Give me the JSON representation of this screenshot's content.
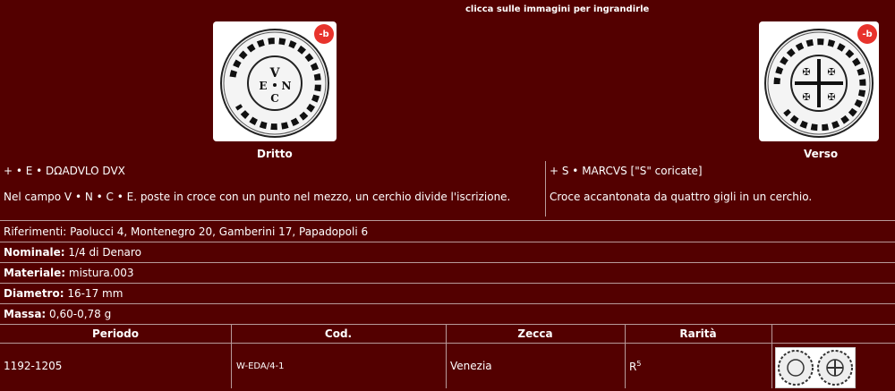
{
  "hint": "clicca sulle immagini per ingrandirle",
  "obverse": {
    "caption": "Dritto",
    "legend": "+ • E • DΩADVLO DVX",
    "field": "Nel campo V • N • C • E. poste in croce con un punto nel mezzo, un cerchio divide l'iscrizione.",
    "image_icon": "coin-obverse-image"
  },
  "reverse": {
    "caption": "Verso",
    "legend": "+ S • MARCVS [\"S\" coricate]",
    "field": "Croce accantonata da quattro gigli in un cerchio.",
    "image_icon": "coin-reverse-image"
  },
  "badge_text": "-b",
  "details": {
    "riferimenti": "Riferimenti: Paolucci 4, Montenegro 20, Gamberini 17, Papadopoli 6",
    "nominale_label": "Nominale:",
    "nominale_value": " 1/4 di Denaro",
    "materiale_label": "Materiale:",
    "materiale_value": " mistura.003",
    "diametro_label": "Diametro:",
    "diametro_value": " 16-17 mm",
    "massa_label": "Massa:",
    "massa_value": " 0,60-0,78 g"
  },
  "table": {
    "headers": [
      "Periodo",
      "Cod.",
      "Zecca",
      "Rarità"
    ],
    "row": {
      "periodo": "1192-1205",
      "cod": "W-EDA/4-1",
      "zecca": "Venezia",
      "rarita": "R",
      "rarita_sup": "5"
    }
  },
  "colors": {
    "background": "#530000",
    "badge": "#e8332c"
  }
}
